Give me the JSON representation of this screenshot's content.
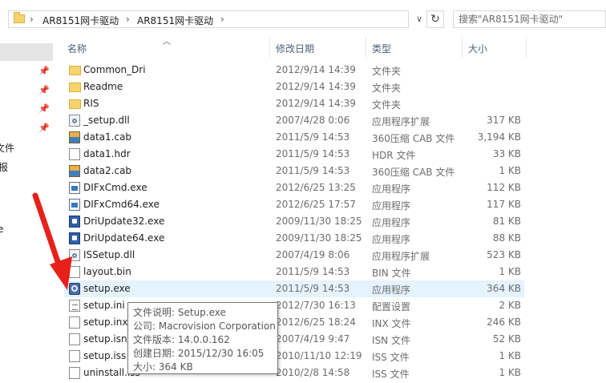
{
  "address": {
    "crumbs": [
      "AR8151网卡驱动",
      "AR8151网卡驱动"
    ],
    "separator": "›",
    "dropdown_glyph": "∨",
    "refresh_glyph": "↻"
  },
  "search": {
    "placeholder": "搜索\"AR8151网卡驱动\""
  },
  "nav": {
    "visible_text": [
      "文件",
      "报",
      "e"
    ]
  },
  "columns": {
    "name": "名称",
    "date": "修改日期",
    "type": "类型",
    "size": "大小"
  },
  "files": [
    {
      "name": "Common_Dri",
      "date": "2012/9/14 14:39",
      "type": "文件夹",
      "size": "",
      "icon": "folder-icon"
    },
    {
      "name": "Readme",
      "date": "2012/9/14 14:39",
      "type": "文件夹",
      "size": "",
      "icon": "folder-icon"
    },
    {
      "name": "RIS",
      "date": "2012/9/14 14:39",
      "type": "文件夹",
      "size": "",
      "icon": "folder-icon"
    },
    {
      "name": "_setup.dll",
      "date": "2007/4/28 0:06",
      "type": "应用程序扩展",
      "size": "317 KB",
      "icon": "dll-icon"
    },
    {
      "name": "data1.cab",
      "date": "2011/5/9 14:53",
      "type": "360压缩 CAB 文件",
      "size": "3,194 KB",
      "icon": "cab-icon"
    },
    {
      "name": "data1.hdr",
      "date": "2011/5/9 14:53",
      "type": "HDR 文件",
      "size": "33 KB",
      "icon": "file-icon"
    },
    {
      "name": "data2.cab",
      "date": "2011/5/9 14:53",
      "type": "360压缩 CAB 文件",
      "size": "1 KB",
      "icon": "cab-icon"
    },
    {
      "name": "DIFxCmd.exe",
      "date": "2012/6/25 13:25",
      "type": "应用程序",
      "size": "112 KB",
      "icon": "exe-icon"
    },
    {
      "name": "DIFxCmd64.exe",
      "date": "2012/6/25 17:57",
      "type": "应用程序",
      "size": "117 KB",
      "icon": "exe-icon"
    },
    {
      "name": "DriUpdate32.exe",
      "date": "2009/11/30 18:25",
      "type": "应用程序",
      "size": "81 KB",
      "icon": "driver-update-icon"
    },
    {
      "name": "DriUpdate64.exe",
      "date": "2009/11/30 18:25",
      "type": "应用程序",
      "size": "88 KB",
      "icon": "driver-update-icon"
    },
    {
      "name": "ISSetup.dll",
      "date": "2007/4/19 8:06",
      "type": "应用程序扩展",
      "size": "523 KB",
      "icon": "dll-icon"
    },
    {
      "name": "layout.bin",
      "date": "2011/5/9 14:53",
      "type": "BIN 文件",
      "size": "1 KB",
      "icon": "file-icon"
    },
    {
      "name": "setup.exe",
      "date": "2011/5/9 14:53",
      "type": "应用程序",
      "size": "364 KB",
      "icon": "setup-icon"
    },
    {
      "name": "setup.ini",
      "date": "2012/7/30 16:13",
      "type": "配置设置",
      "size": "2 KB",
      "icon": "settings-file-icon"
    },
    {
      "name": "setup.inx",
      "date": "2012/6/25 18:24",
      "type": "INX 文件",
      "size": "246 KB",
      "icon": "file-icon"
    },
    {
      "name": "setup.isn",
      "date": "2007/4/19 9:47",
      "type": "ISN 文件",
      "size": "52 KB",
      "icon": "file-icon"
    },
    {
      "name": "setup.iss",
      "date": "2010/11/10 12:19",
      "type": "ISS 文件",
      "size": "1 KB",
      "icon": "file-icon"
    },
    {
      "name": "uninstall.iss",
      "date": "2010/2/8 14:58",
      "type": "ISS 文件",
      "size": "1 KB",
      "icon": "file-icon"
    }
  ],
  "hovered_file": "setup.exe",
  "tooltip": {
    "lines": [
      "文件说明: Setup.exe",
      "公司: Macrovision Corporation",
      "文件版本: 14.0.0.162",
      "创建日期: 2015/12/30 16:05",
      "大小: 364 KB"
    ]
  },
  "colors": {
    "hover_row": "#e5f3ff",
    "header_text": "#4c607a",
    "arrow": "#e8201a"
  }
}
